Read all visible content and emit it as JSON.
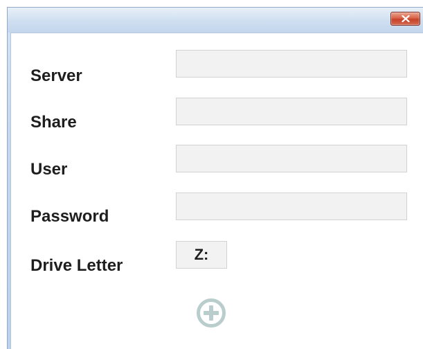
{
  "window": {
    "close_icon": "close-icon",
    "close_color": "#c6412a"
  },
  "form": {
    "server_label": "Server",
    "share_label": "Share",
    "user_label": "User",
    "password_label": "Password",
    "drive_letter_label": "Drive Letter",
    "server_value": "",
    "share_value": "",
    "user_value": "",
    "password_value": "",
    "drive_letter_value": "Z:"
  },
  "actions": {
    "add_icon": "plus-circle-icon",
    "add_color": "#b9cdcd"
  }
}
